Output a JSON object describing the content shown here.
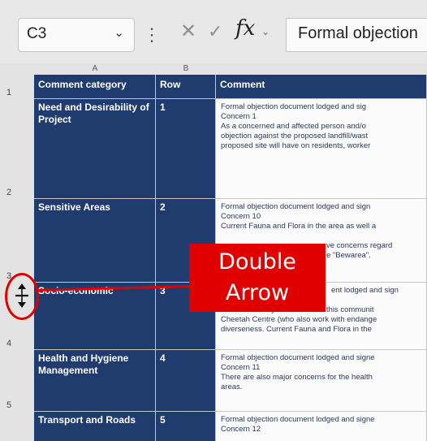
{
  "formula_bar": {
    "name_box": "C3",
    "formula_text": "Formal objection",
    "fx_label": "fx"
  },
  "columns": [
    {
      "letter": ""
    },
    {
      "letter": "A"
    },
    {
      "letter": "B"
    },
    {
      "letter": ""
    }
  ],
  "header_row": {
    "row": "1",
    "col_a": "Comment category",
    "col_b": "Row",
    "col_c": "Comment"
  },
  "rows": [
    {
      "row": "2",
      "category": "Need and Desirability of Project",
      "number": "1",
      "lines": [
        "Formal objection document lodged and sig",
        "Concern 1",
        "As a concerned and affected person and/o",
        "objection against the proposed landfill/wast",
        "proposed site will have on residents, worker"
      ]
    },
    {
      "row": "3",
      "category": "Sensitive Areas",
      "number": "2",
      "lines": [
        "Formal objection document lodged and sign",
        "Concern 10",
        "Current Fauna and Flora in the area as well a",
        "",
        "ve concerns regard",
        "e \"Bewarea\"."
      ]
    },
    {
      "row": "4",
      "category": "Socio-economic",
      "number": "3",
      "lines": [
        "ent lodged and sign",
        "",
        "There are many businesses in this communit",
        "Cheetah Centre (who also work with endange",
        "diverseness. Current Fauna and Flora in the"
      ]
    },
    {
      "row": "5",
      "category": "Health and Hygiene Management",
      "number": "4",
      "lines": [
        "Formal objection document lodged and signe",
        "Concern 11",
        "There are also major concerns for the health",
        "areas."
      ]
    },
    {
      "row": "",
      "category": "Transport and Roads",
      "number": "5",
      "lines": [
        "Formal objection document lodged and signe",
        "Concern 12"
      ]
    }
  ],
  "annotation": {
    "line1": "Double",
    "line2": "Arrow"
  },
  "colors": {
    "accent_navy": "#203b6e",
    "annotation_red": "#e00000"
  }
}
